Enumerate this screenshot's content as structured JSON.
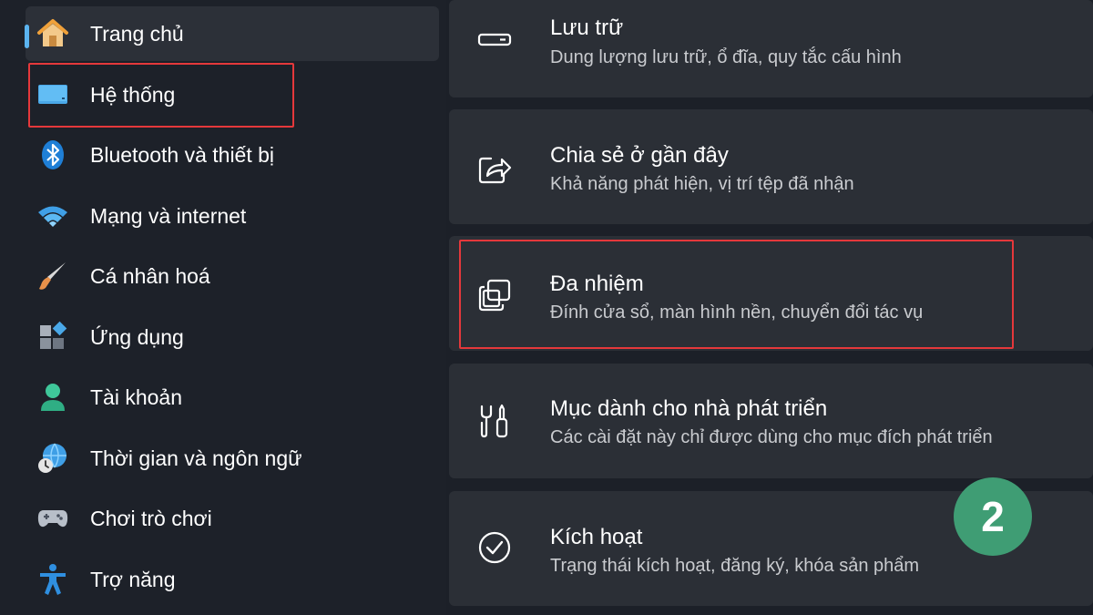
{
  "sidebar": {
    "items": [
      {
        "label": "Trang chủ",
        "icon": "home-icon"
      },
      {
        "label": "Hệ thống",
        "icon": "monitor-icon"
      },
      {
        "label": "Bluetooth và thiết bị",
        "icon": "bluetooth-icon"
      },
      {
        "label": "Mạng và internet",
        "icon": "wifi-icon"
      },
      {
        "label": "Cá nhân hoá",
        "icon": "brush-icon"
      },
      {
        "label": "Ứng dụng",
        "icon": "apps-icon"
      },
      {
        "label": "Tài khoản",
        "icon": "account-icon"
      },
      {
        "label": "Thời gian và ngôn ngữ",
        "icon": "time-language-icon"
      },
      {
        "label": "Chơi trò chơi",
        "icon": "gamepad-icon"
      },
      {
        "label": "Trợ năng",
        "icon": "accessibility-icon"
      }
    ],
    "selected": "Trang chủ"
  },
  "main": {
    "cards": [
      {
        "title": "Lưu trữ",
        "subtitle": "Dung lượng lưu trữ, ổ đĩa, quy tắc cấu hình",
        "icon": "storage-icon"
      },
      {
        "title": "Chia sẻ ở gần đây",
        "subtitle": "Khả năng phát hiện, vị trí tệp đã nhận",
        "icon": "share-icon"
      },
      {
        "title": "Đa nhiệm",
        "subtitle": "Đính cửa sổ, màn hình nền, chuyển đổi tác vụ",
        "icon": "multitasking-icon"
      },
      {
        "title": "Mục dành cho nhà phát triển",
        "subtitle": "Các cài đặt này chỉ được dùng cho mục đích phát triển",
        "icon": "developer-tools-icon"
      },
      {
        "title": "Kích hoạt",
        "subtitle": "Trạng thái kích hoạt, đăng ký, khóa sản phẩm",
        "icon": "activation-check-icon"
      }
    ]
  },
  "annotation": {
    "step_number": "2"
  },
  "colors": {
    "background": "#1c2028",
    "card": "#2b2f36",
    "accent": "#5bb4f0",
    "highlight_box": "#e5383b",
    "step_badge": "#3f9d74"
  }
}
